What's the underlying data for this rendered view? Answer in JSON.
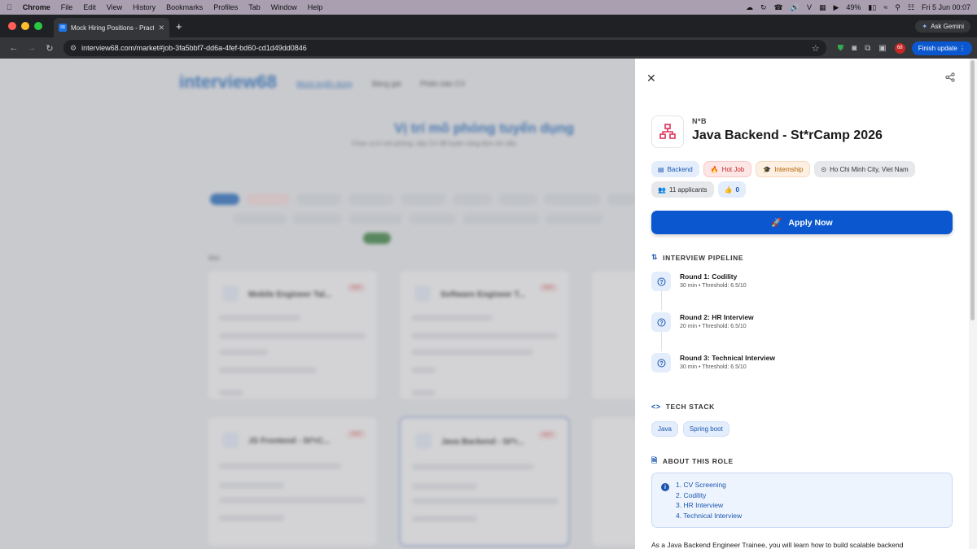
{
  "menubar": {
    "apple": "",
    "items": [
      "Chrome",
      "File",
      "Edit",
      "View",
      "History",
      "Bookmarks",
      "Profiles",
      "Tab",
      "Window",
      "Help"
    ],
    "battery": "49%",
    "datetime": "Fri 5 Jun  00:07"
  },
  "browser": {
    "tab_title": "Mock Hiring Positions - Pract",
    "tab_favicon": "68",
    "url": "interview68.com/market#job-3fa5bbf7-dd6a-4fef-bd60-cd1d49dd0846",
    "ask_gemini": "Ask Gemini",
    "finish_update": "Finish update",
    "profile_badge": "68"
  },
  "background_page": {
    "logo": "interview68",
    "nav": [
      "Mock tuyển dụng",
      "Bảng giá",
      "Phiên bản CV"
    ],
    "title": "Vị trí mô phỏng tuyển dụng",
    "subtitle": "Chọn vị trí mô phỏng, nộp CV để luyện vòng đơn xin việc",
    "section": "Mới"
  },
  "panel": {
    "company": "N*B",
    "title": "Java Backend - St*rCamp 2026",
    "tags": [
      {
        "label": "Backend",
        "style": "blue",
        "icon": "layers-icon"
      },
      {
        "label": "Hot Job",
        "style": "red",
        "icon": "fire-icon"
      },
      {
        "label": "Internship",
        "style": "orange",
        "icon": "grad-cap-icon"
      },
      {
        "label": "Ho Chi Minh City, Viet Nam",
        "style": "gray",
        "icon": "location-icon"
      },
      {
        "label": "11 applicants",
        "style": "gray",
        "icon": "users-icon"
      },
      {
        "label": "0",
        "style": "blue",
        "icon": "thumbs-up-icon"
      }
    ],
    "apply_label": "Apply Now",
    "pipeline_heading": "INTERVIEW PIPELINE",
    "rounds": [
      {
        "title": "Round 1: Codility",
        "meta": "30 min • Threshold: 6.5/10"
      },
      {
        "title": "Round 2: HR Interview",
        "meta": "20 min • Threshold: 6.5/10"
      },
      {
        "title": "Round 3: Technical Interview",
        "meta": "30 min • Threshold: 6.5/10"
      }
    ],
    "stack_heading": "TECH STACK",
    "stack": [
      "Java",
      "Spring boot"
    ],
    "about_heading": "ABOUT THIS ROLE",
    "about_list": [
      "1. CV Screening",
      "2. Codility",
      "3. HR Interview",
      "4. Technical Interview"
    ],
    "description": "As a Java Backend Engineer Trainee, you will learn how to build scalable backend"
  },
  "colors": {
    "primary": "#0b57d0",
    "accent_blue": "#1a56b0",
    "hot": "#c62828",
    "internship": "#b35f00"
  }
}
